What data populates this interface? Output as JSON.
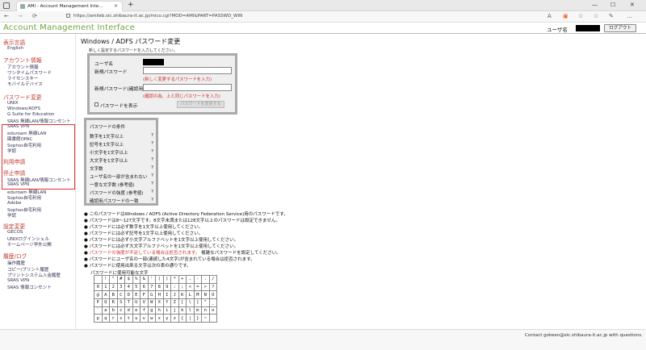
{
  "browser": {
    "tab_title": "AMI - Account Management Inte...",
    "tab_close": "×",
    "new_tab": "+",
    "url": "https://amileb.sic.shibaura-it.ac.jp/mico.cgi?MOD=AMI&PART=PASSWD_WIN",
    "min": "—",
    "max": "☐",
    "close": "✕",
    "back": "←",
    "forward": "→",
    "reload": "⟳",
    "nav_icons": [
      "A",
      "☆",
      "☆",
      "✎",
      "…"
    ]
  },
  "app": {
    "brand": "Account Management Interface",
    "user_label": "ユーザ名",
    "logout": "ログアウト"
  },
  "sidebar": {
    "sections": [
      {
        "heading": "表示言語",
        "items": [
          "English"
        ]
      },
      {
        "heading": "アカウント情報",
        "items": [
          "アカウント情報",
          "ワンタイムパスワード",
          "ライセンスキー",
          "モバイルデバイス"
        ]
      },
      {
        "heading": "パスワード変更",
        "items": [
          "UNIX",
          "Windows/ADFS",
          "G Suite for Education",
          "SRAS 無線LAN/情報コンセント",
          "SRAS VPN",
          "eduroam 無線LAN",
          "図書館OPAC",
          "Sophos自宅利用",
          "学認"
        ]
      },
      {
        "heading": "利用申請",
        "items": []
      },
      {
        "heading": "停止申請",
        "items": [
          "SRAS 無線LAN/情報コンセント",
          "SRAS VPN",
          "eduroam 無線LAN",
          "Sophos自宅利用",
          "Adobe",
          "Sophos自宅利用",
          "学認"
        ]
      },
      {
        "heading": "設定変更",
        "items": [
          "GECOS",
          "UNIXログインシェル",
          "ホームページ学外公開"
        ]
      },
      {
        "heading": "履歴/ログ",
        "items": [
          "操作履歴",
          "コピー/プリント履歴",
          "プリントシステム入金履歴",
          "SRAS VPN",
          "SRAS 情報コンセント"
        ]
      }
    ]
  },
  "main": {
    "title": "Windows / ADFS パスワード変更",
    "subtitle": "新しく設定するパスワードを入力してください。",
    "form": {
      "user_label": "ユーザ名",
      "new_pw_label": "新規パスワード",
      "confirm_label": "新規パスワード(確認用)",
      "note_new": "(新しく変更するパスワードを入力)",
      "note_confirm": "(確認の為、上と同じパスワードを入力)",
      "show_pw": "パスワードを表示",
      "submit": "パスワードを変更する"
    },
    "conditions": {
      "title": "パスワードの条件",
      "items": [
        "数字を1文字以上",
        "記号を1文字以上",
        "小文字を1文字以上",
        "大文字を1文字以上",
        "文字数",
        "ユーザ名の一部が含まれない",
        "一意な文字数 (参考値)",
        "パスワードの強度 (参考値)",
        "確認用パスワードの一致"
      ],
      "mark": "?"
    },
    "bullets": [
      {
        "text": "このパスワードはWindows / ADFS (Active Directory Federation Service)用のパスワードです。",
        "red": false
      },
      {
        "text": "パスワードは8～127文字です。8文字未満または128文字以上のパスワードは設定できません。",
        "red": false
      },
      {
        "text": "パスワードには必ず数字を1文字以上使用してください。",
        "red": false
      },
      {
        "text": "パスワードには必ず記号を1文字以上使用してください。",
        "red": false
      },
      {
        "text": "パスワードには必ず小文字アルファベットを1文字以上使用してください。",
        "red": false
      },
      {
        "text": "パスワードには必ず大文字アルファベットを1文字以上使用してください。",
        "red": false
      },
      {
        "text": "パスワードの強度が不足している場合は拒否されます。",
        "red": true,
        "tail": "複雑なパスワードを設定してください。"
      },
      {
        "text": "パスワードにユーザ名の一部(連続した4文字)が含まれている場合は拒否されます。",
        "red": false
      },
      {
        "text": "パスワードに使用出来る文字は次の表の通りです。",
        "red": false
      }
    ],
    "chartable_title": "パスワードに使用可能な文字",
    "chartable": [
      [
        " ",
        "!",
        "\"",
        "#",
        "$",
        "%",
        "&",
        "'",
        "(",
        ")",
        "*",
        "+",
        ",",
        "-",
        ".",
        "/"
      ],
      [
        "0",
        "1",
        "2",
        "3",
        "4",
        "5",
        "6",
        "7",
        "8",
        "9",
        ":",
        ";",
        "<",
        "=",
        ">",
        "?"
      ],
      [
        "@",
        "A",
        "B",
        "C",
        "D",
        "E",
        "F",
        "G",
        "H",
        "I",
        "J",
        "K",
        "L",
        "M",
        "N",
        "O"
      ],
      [
        "P",
        "Q",
        "R",
        "S",
        "T",
        "U",
        "V",
        "W",
        "X",
        "Y",
        "Z",
        "[",
        "\\",
        "]",
        "^",
        "_"
      ],
      [
        "`",
        "a",
        "b",
        "c",
        "d",
        "e",
        "f",
        "g",
        "h",
        "i",
        "j",
        "k",
        "l",
        "m",
        "n",
        "o"
      ],
      [
        "p",
        "q",
        "r",
        "s",
        "t",
        "u",
        "v",
        "w",
        "x",
        "y",
        "z",
        "{",
        "|",
        "}",
        "~",
        ""
      ]
    ]
  },
  "footer": {
    "contact": "Contact gokeen@sic.shibaura-it.ac.jp with questions."
  }
}
